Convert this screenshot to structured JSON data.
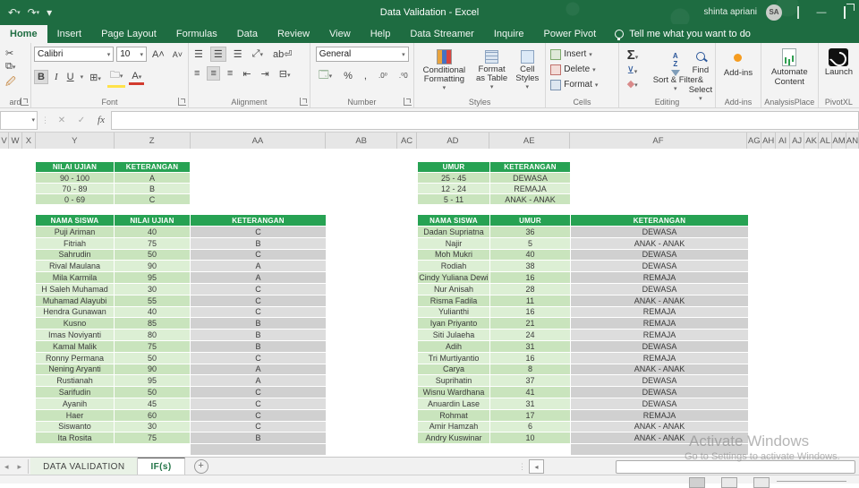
{
  "titlebar": {
    "title": "Data Validation - Excel",
    "user": "shinta apriani",
    "avatar_initials": "SA"
  },
  "ribbon_tabs": [
    {
      "label": "Home",
      "active": true
    },
    {
      "label": "Insert",
      "active": false
    },
    {
      "label": "Page Layout",
      "active": false
    },
    {
      "label": "Formulas",
      "active": false
    },
    {
      "label": "Data",
      "active": false
    },
    {
      "label": "Review",
      "active": false
    },
    {
      "label": "View",
      "active": false
    },
    {
      "label": "Help",
      "active": false
    },
    {
      "label": "Data Streamer",
      "active": false
    },
    {
      "label": "Inquire",
      "active": false
    },
    {
      "label": "Power Pivot",
      "active": false
    }
  ],
  "tellme": "Tell me what you want to do",
  "ribbon": {
    "clipboard": {
      "group_label": "ard"
    },
    "font": {
      "name": "Calibri",
      "size": "10",
      "group_label": "Font",
      "bold": "B",
      "italic": "I",
      "underline": "U"
    },
    "alignment": {
      "group_label": "Alignment"
    },
    "number": {
      "format": "General",
      "group_label": "Number",
      "percent": "%",
      "comma": ","
    },
    "styles": {
      "conditional": "Conditional Formatting",
      "format_table": "Format as Table",
      "cell_styles": "Cell Styles",
      "group_label": "Styles"
    },
    "cells": {
      "insert": "Insert",
      "delete": "Delete",
      "format": "Format",
      "group_label": "Cells"
    },
    "editing": {
      "sort_filter": "Sort & Filter",
      "find_select": "Find & Select",
      "group_label": "Editing"
    },
    "addins": {
      "button": "Add-ins",
      "group_label": "Add-ins"
    },
    "analysisplace": {
      "button": "Automate Content",
      "group_label": "AnalysisPlace"
    },
    "pivotxl": {
      "button": "Launch",
      "group_label": "PivotXL"
    }
  },
  "grid": {
    "columns": [
      "V",
      "W",
      "X",
      "Y",
      "Z",
      "AA",
      "AB",
      "AC",
      "AD",
      "AE",
      "AF",
      "AG",
      "AH",
      "AI",
      "AJ",
      "AK",
      "AL",
      "AM",
      "AN"
    ]
  },
  "tables": {
    "score_ref": {
      "headers": [
        "NILAI UJIAN",
        "KETERANGAN"
      ],
      "rows": [
        [
          "90 - 100",
          "A"
        ],
        [
          "70 - 89",
          "B"
        ],
        [
          "0 - 69",
          "C"
        ]
      ]
    },
    "age_ref": {
      "headers": [
        "UMUR",
        "KETERANGAN"
      ],
      "rows": [
        [
          "25 - 45",
          "DEWASA"
        ],
        [
          "12 - 24",
          "REMAJA"
        ],
        [
          "5 - 11",
          "ANAK - ANAK"
        ]
      ]
    },
    "scores": {
      "headers": [
        "NAMA SISWA",
        "NILAI UJIAN",
        "KETERANGAN"
      ],
      "rows": [
        [
          "Puji Ariman",
          "40",
          "C"
        ],
        [
          "Fitriah",
          "75",
          "B"
        ],
        [
          "Sahrudin",
          "50",
          "C"
        ],
        [
          "Rival Maulana",
          "90",
          "A"
        ],
        [
          "Mila Karmila",
          "95",
          "A"
        ],
        [
          "H Saleh Muhamad",
          "30",
          "C"
        ],
        [
          "Muhamad Alayubi",
          "55",
          "C"
        ],
        [
          "Hendra Gunawan",
          "40",
          "C"
        ],
        [
          "Kusno",
          "85",
          "B"
        ],
        [
          "Imas Noviyanti",
          "80",
          "B"
        ],
        [
          "Kamal Malik",
          "75",
          "B"
        ],
        [
          "Ronny Permana",
          "50",
          "C"
        ],
        [
          "Nening Aryanti",
          "90",
          "A"
        ],
        [
          "Rustianah",
          "95",
          "A"
        ],
        [
          "Sarifudin",
          "50",
          "C"
        ],
        [
          "Ayanih",
          "45",
          "C"
        ],
        [
          "Haer",
          "60",
          "C"
        ],
        [
          "Siswanto",
          "30",
          "C"
        ],
        [
          "Ita Rosita",
          "75",
          "B"
        ]
      ]
    },
    "ages": {
      "headers": [
        "NAMA SISWA",
        "UMUR",
        "KETERANGAN"
      ],
      "rows": [
        [
          "Dadan Supriatna",
          "36",
          "DEWASA"
        ],
        [
          "Najir",
          "5",
          "ANAK - ANAK"
        ],
        [
          "Moh Mukri",
          "40",
          "DEWASA"
        ],
        [
          "Rodiah",
          "38",
          "DEWASA"
        ],
        [
          "Cindy Yuliana Dewi",
          "16",
          "REMAJA"
        ],
        [
          "Nur Anisah",
          "28",
          "DEWASA"
        ],
        [
          "Risma Fadila",
          "11",
          "ANAK - ANAK"
        ],
        [
          "Yulianthi",
          "16",
          "REMAJA"
        ],
        [
          "Iyan Priyanto",
          "21",
          "REMAJA"
        ],
        [
          "Siti Julaeha",
          "24",
          "REMAJA"
        ],
        [
          "Adih",
          "31",
          "DEWASA"
        ],
        [
          "Tri Murtiyantio",
          "16",
          "REMAJA"
        ],
        [
          "Carya",
          "8",
          "ANAK - ANAK"
        ],
        [
          "Suprihatin",
          "37",
          "DEWASA"
        ],
        [
          "Wisnu Wardhana",
          "41",
          "DEWASA"
        ],
        [
          "Anuardin Lase",
          "31",
          "DEWASA"
        ],
        [
          "Rohmat",
          "17",
          "REMAJA"
        ],
        [
          "Amir Hamzah",
          "6",
          "ANAK - ANAK"
        ],
        [
          "Andry Kuswinar",
          "10",
          "ANAK - ANAK"
        ]
      ]
    }
  },
  "sheet_tabs": [
    {
      "label": "DATA VALIDATION",
      "active": false,
      "tinted": true
    },
    {
      "label": "IF(s)",
      "active": true,
      "tinted": false
    }
  ],
  "watermark": {
    "line1": "Activate Windows",
    "line2": "Go to Settings to activate Windows."
  },
  "colors": {
    "excel_green": "#1e6c41",
    "table_header_green": "#27a253",
    "cell_green_dark": "#c9e4bd",
    "cell_green_light": "#dcefd4",
    "cell_gray_dark": "#d0d0d0",
    "cell_gray_light": "#dddddd"
  }
}
